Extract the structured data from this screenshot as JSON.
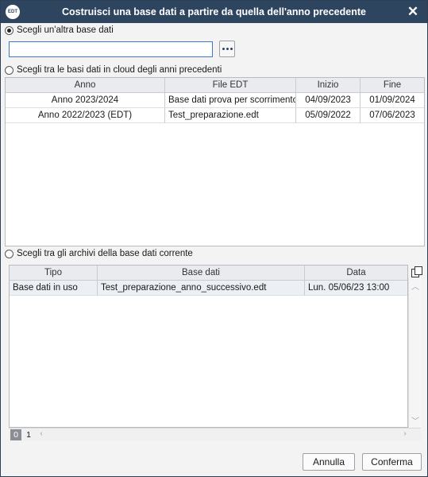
{
  "dialog": {
    "app_icon_text": "EDT",
    "title": "Costruisci una base dati a partire da quella dell'anno precedente",
    "close_glyph": "✕"
  },
  "option_other_db": {
    "label": "Scegli un'altra base dati",
    "selected": true,
    "input_value": "",
    "input_placeholder": ""
  },
  "option_cloud": {
    "label": "Scegli tra le basi dati in cloud degli anni precedenti",
    "selected": false,
    "columns": [
      "Anno",
      "File EDT",
      "Inizio",
      "Fine"
    ],
    "rows": [
      {
        "anno": "Anno 2023/2024",
        "file": "Base dati prova per scorrimento.",
        "inizio": "04/09/2023",
        "fine": "01/09/2024"
      },
      {
        "anno": "Anno 2022/2023 (EDT)",
        "file": "Test_preparazione.edt",
        "inizio": "05/09/2022",
        "fine": "07/06/2023"
      }
    ]
  },
  "option_archives": {
    "label": "Scegli tra gli archivi della base dati corrente",
    "selected": false,
    "columns": [
      "Tipo",
      "Base dati",
      "Data"
    ],
    "rows": [
      {
        "tipo": "Base dati in uso",
        "base": "Test_preparazione_anno_successivo.edt",
        "data": "Lun. 05/06/23 13:00"
      }
    ],
    "pages": [
      "0",
      "1"
    ],
    "active_page": "0"
  },
  "buttons": {
    "cancel": "Annulla",
    "confirm": "Conferma"
  },
  "colors": {
    "titlebar": "#2e4560",
    "input_border": "#3b78c8"
  }
}
